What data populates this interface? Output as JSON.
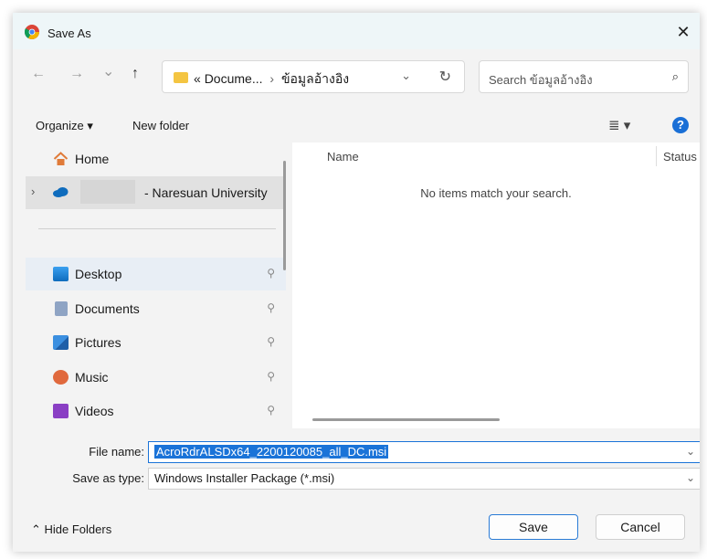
{
  "window": {
    "title": "Save As",
    "close_glyph": "✕"
  },
  "nav": {
    "back_glyph": "←",
    "forward_glyph": "→",
    "recent_glyph": "⌄",
    "up_glyph": "↑",
    "breadcrumb": {
      "prefix": "«",
      "folder": "Docume...",
      "separator": "›",
      "current": "ข้อมูลอ้างอิง"
    },
    "dropdown_glyph": "⌄",
    "refresh_glyph": "↻",
    "search_placeholder": "Search ข้อมูลอ้างอิง",
    "search_glyph": "⌕"
  },
  "toolbar": {
    "organize": "Organize ▾",
    "new_folder": "New folder",
    "view_glyph": "≣ ▾",
    "help_glyph": "?"
  },
  "sidebar": {
    "items": [
      {
        "label": "Home",
        "icon": "home-icon"
      },
      {
        "label": "- Naresuan University",
        "icon": "onedrive-cloud-icon",
        "expand": "›"
      },
      {
        "label": "Desktop",
        "icon": "desktop-icon",
        "pin": "📌"
      },
      {
        "label": "Documents",
        "icon": "documents-icon",
        "pin": "📌"
      },
      {
        "label": "Pictures",
        "icon": "pictures-icon",
        "pin": "📌"
      },
      {
        "label": "Music",
        "icon": "music-icon",
        "pin": "📌"
      },
      {
        "label": "Videos",
        "icon": "videos-icon",
        "pin": "📌"
      }
    ]
  },
  "content": {
    "columns": [
      "Name",
      "Status"
    ],
    "empty_message": "No items match your search."
  },
  "form": {
    "file_name_label": "File name:",
    "file_name_value": "AcroRdrALSDx64_2200120085_all_DC.msi",
    "save_type_label": "Save as type:",
    "save_type_value": "Windows Installer Package (*.msi)",
    "dd_glyph": "⌄"
  },
  "footer": {
    "hide_folders": "⌃  Hide Folders",
    "save": "Save",
    "cancel": "Cancel"
  },
  "colors": {
    "accent": "#1a73d8",
    "folder": "#f4c542"
  }
}
